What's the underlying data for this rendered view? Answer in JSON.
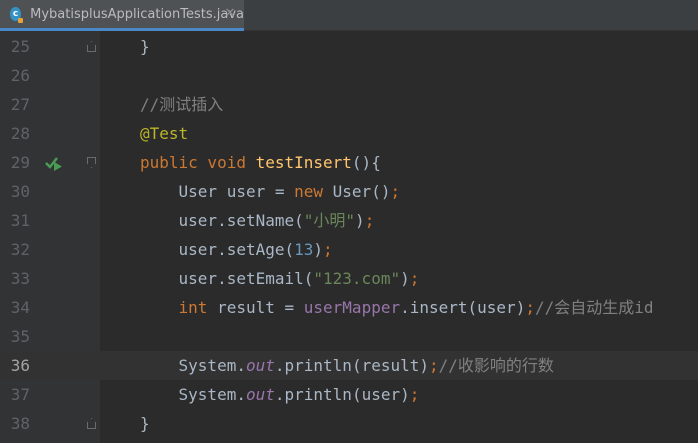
{
  "tab": {
    "icon_letter": "c",
    "filename": "MybatisplusApplicationTests.java",
    "close": "✕"
  },
  "editor": {
    "current_line": 36,
    "lines": [
      {
        "num": "25",
        "tokens": [
          {
            "t": "}",
            "c": "plain"
          }
        ]
      },
      {
        "num": "26",
        "tokens": []
      },
      {
        "num": "27",
        "tokens": [
          {
            "t": "//测试插入",
            "c": "cmt"
          }
        ]
      },
      {
        "num": "28",
        "tokens": [
          {
            "t": "@Test",
            "c": "ann"
          }
        ]
      },
      {
        "num": "29",
        "tokens": [
          {
            "t": "public void ",
            "c": "kw"
          },
          {
            "t": "testInsert",
            "c": "fn"
          },
          {
            "t": "(){",
            "c": "plain"
          }
        ]
      },
      {
        "num": "30",
        "tokens": [
          {
            "t": "    User user = ",
            "c": "plain"
          },
          {
            "t": "new ",
            "c": "kw"
          },
          {
            "t": "User()",
            "c": "plain"
          },
          {
            "t": ";",
            "c": "kw"
          }
        ]
      },
      {
        "num": "31",
        "tokens": [
          {
            "t": "    user.setName(",
            "c": "plain"
          },
          {
            "t": "\"小明\"",
            "c": "str"
          },
          {
            "t": ")",
            "c": "plain"
          },
          {
            "t": ";",
            "c": "kw"
          }
        ]
      },
      {
        "num": "32",
        "tokens": [
          {
            "t": "    user.setAge(",
            "c": "plain"
          },
          {
            "t": "13",
            "c": "num"
          },
          {
            "t": ")",
            "c": "plain"
          },
          {
            "t": ";",
            "c": "kw"
          }
        ]
      },
      {
        "num": "33",
        "tokens": [
          {
            "t": "    user.setEmail(",
            "c": "plain"
          },
          {
            "t": "\"123.com\"",
            "c": "str"
          },
          {
            "t": ")",
            "c": "plain"
          },
          {
            "t": ";",
            "c": "kw"
          }
        ]
      },
      {
        "num": "34",
        "tokens": [
          {
            "t": "    ",
            "c": "plain"
          },
          {
            "t": "int ",
            "c": "kw"
          },
          {
            "t": "result = ",
            "c": "plain"
          },
          {
            "t": "userMapper",
            "c": "ufld"
          },
          {
            "t": ".insert(user)",
            "c": "plain"
          },
          {
            "t": ";",
            "c": "kw"
          },
          {
            "t": "//会自动生成id",
            "c": "cmt"
          }
        ]
      },
      {
        "num": "35",
        "tokens": []
      },
      {
        "num": "36",
        "tokens": [
          {
            "t": "    System.",
            "c": "plain"
          },
          {
            "t": "out",
            "c": "fld"
          },
          {
            "t": ".println(result)",
            "c": "plain"
          },
          {
            "t": ";",
            "c": "kw"
          },
          {
            "t": "//收影响的行数",
            "c": "cmt"
          }
        ]
      },
      {
        "num": "37",
        "tokens": [
          {
            "t": "    System.",
            "c": "plain"
          },
          {
            "t": "out",
            "c": "fld"
          },
          {
            "t": ".println(user)",
            "c": "plain"
          },
          {
            "t": ";",
            "c": "kw"
          }
        ]
      },
      {
        "num": "38",
        "tokens": [
          {
            "t": "}",
            "c": "plain"
          }
        ]
      }
    ]
  },
  "colors": {
    "background": "#2b2b2b",
    "gutter": "#313335",
    "keyword": "#cc7832",
    "annotation": "#bbb529",
    "method": "#ffc66d",
    "string": "#6a8759",
    "number": "#6897bb",
    "comment": "#808080",
    "field": "#9876aa",
    "run_icon": "#499c54"
  }
}
